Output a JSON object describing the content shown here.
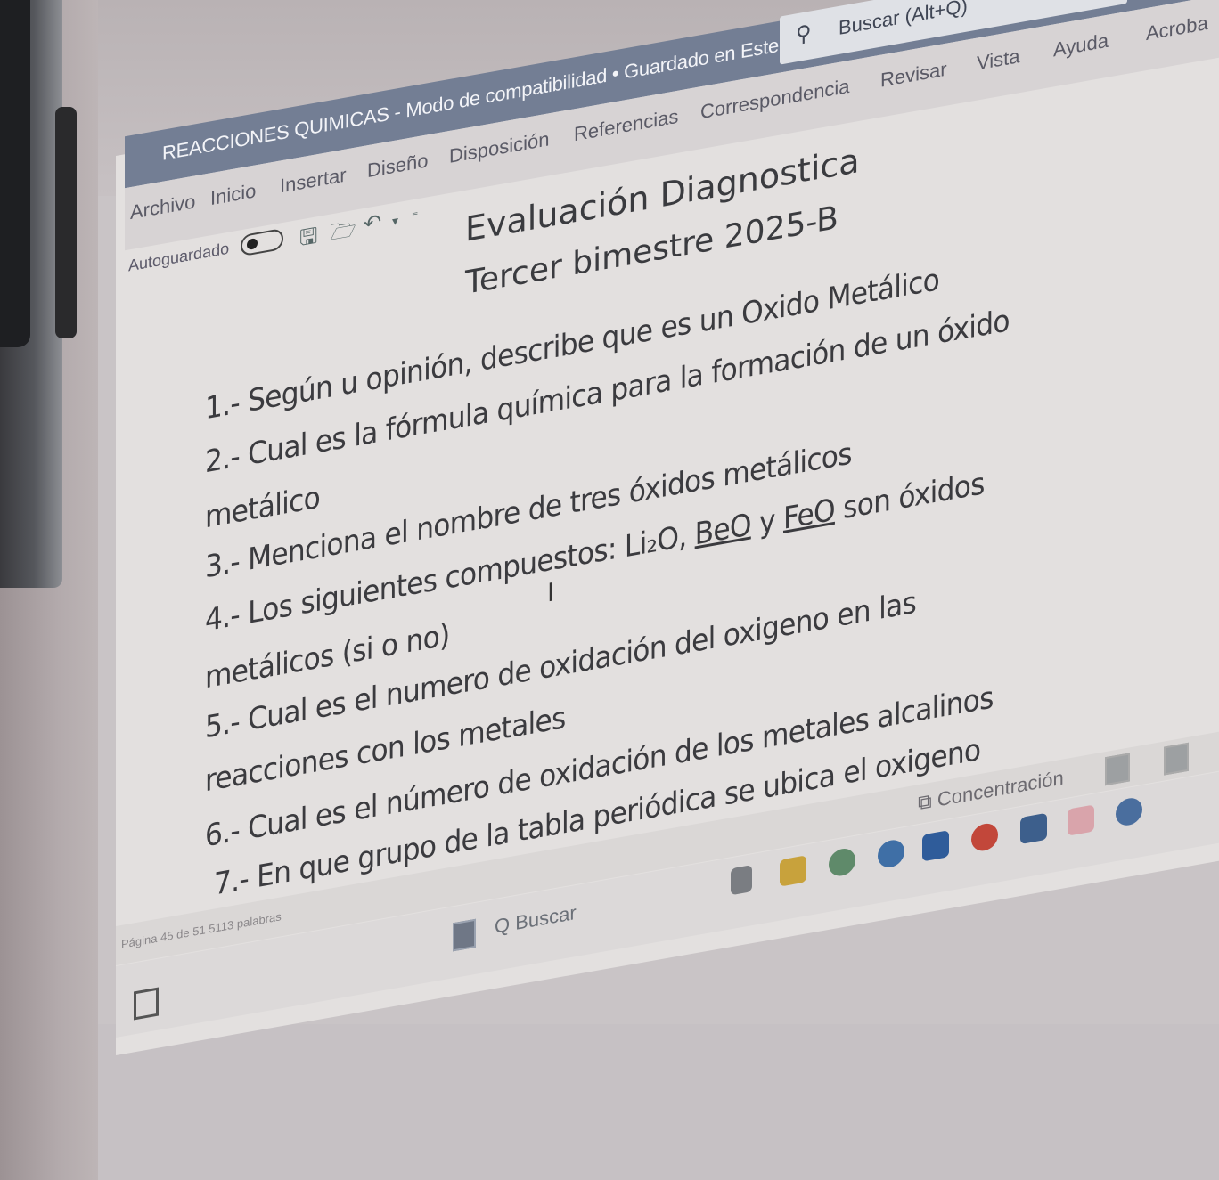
{
  "window": {
    "title": "REACCIONES QUIMICAS  -  Modo de compatibilidad • Guardado en Este PC ▾",
    "search_icon": "search-icon",
    "search_label": "Buscar (Alt+Q)"
  },
  "menu": [
    {
      "label": "Archivo"
    },
    {
      "label": "Inicio"
    },
    {
      "label": "Insertar"
    },
    {
      "label": "Diseño"
    },
    {
      "label": "Disposición"
    },
    {
      "label": "Referencias"
    },
    {
      "label": "Correspondencia"
    },
    {
      "label": "Revisar"
    },
    {
      "label": "Vista"
    },
    {
      "label": "Ayuda"
    },
    {
      "label": "Acroba"
    }
  ],
  "quick_access": {
    "autosave_label": "Autoguardado",
    "save_icon": "save-icon",
    "open_icon": "open-folder-icon",
    "undo_icon": "undo-icon"
  },
  "document": {
    "heading1": "Evaluación Diagnostica",
    "heading2": "Tercer bimestre 2025-B",
    "q1": "1.- Según u opinión, describe que es un Oxido Metálico",
    "q2a": "2.- Cual es la fórmula química para la formación de un óxido",
    "q2b": "metálico",
    "q3": "3.- Menciona el nombre de tres óxidos metálicos",
    "q4a_prefix": "4.- Los siguientes compuestos:  ",
    "q4a_c1": "Li₂O",
    "q4a_sep1": ", ",
    "q4a_c2": "BeO",
    "q4a_sep2": " y ",
    "q4a_c3": "FeO",
    "q4a_suffix": " son óxidos",
    "q4b": "metálicos (si o no)",
    "q5a": "5.- Cual es el numero de oxidación del oxigeno en las",
    "q5b": "reacciones con los metales",
    "q6": "6.- Cual es el número de oxidación de los metales alcalinos",
    "q7": "7.- En que grupo de la tabla periódica se ubica el oxigeno",
    "cursor": "I"
  },
  "status": {
    "page_info": "Página 45 de 51    5113 palabras",
    "focus_label": "Concentración"
  },
  "taskbar": {
    "search_label": "Q  Buscar"
  }
}
